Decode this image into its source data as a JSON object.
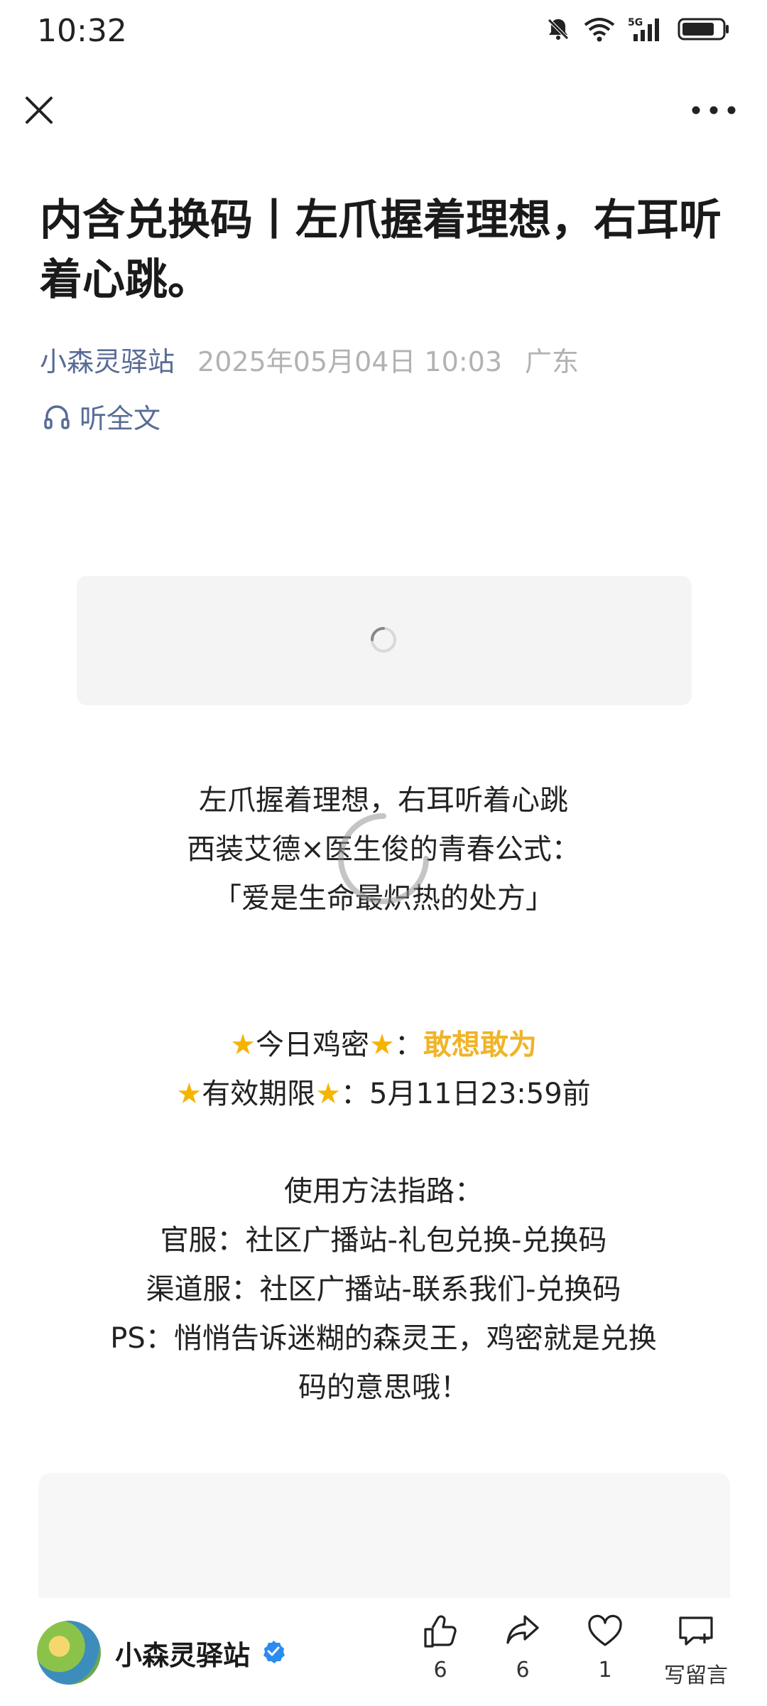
{
  "status_bar": {
    "time": "10:32",
    "network": "5G"
  },
  "article": {
    "title": "内含兑换码丨左爪握着理想，右耳听着心跳。",
    "author": "小森灵驿站",
    "date": "2025年05月04日 10:03",
    "location": "广东",
    "listen_label": "听全文"
  },
  "body": {
    "poem_lines": [
      "左爪握着理想，右耳听着心跳",
      "西装艾德×医生俊的青春公式：",
      "「爱是生命最炽热的处方」"
    ],
    "code_label": "今日鸡密",
    "code_value": "敢想敢为",
    "expiry_label": "有效期限",
    "expiry_value": "5月11日23:59前",
    "usage_title": "使用方法指路：",
    "usage_lines": [
      "官服：社区广播站-礼包兑换-兑换码",
      "渠道服：社区广播站-联系我们-兑换码",
      "PS：悄悄告诉迷糊的森灵王，鸡密就是兑换",
      "码的意思哦！"
    ]
  },
  "bottom_bar": {
    "account_name": "小森灵驿站",
    "like_count": "6",
    "share_count": "6",
    "favorite_count": "1",
    "comment_label": "写留言"
  },
  "colors": {
    "link": "#576b95",
    "highlight": "#f0b429",
    "verified": "#2b8cf0"
  }
}
